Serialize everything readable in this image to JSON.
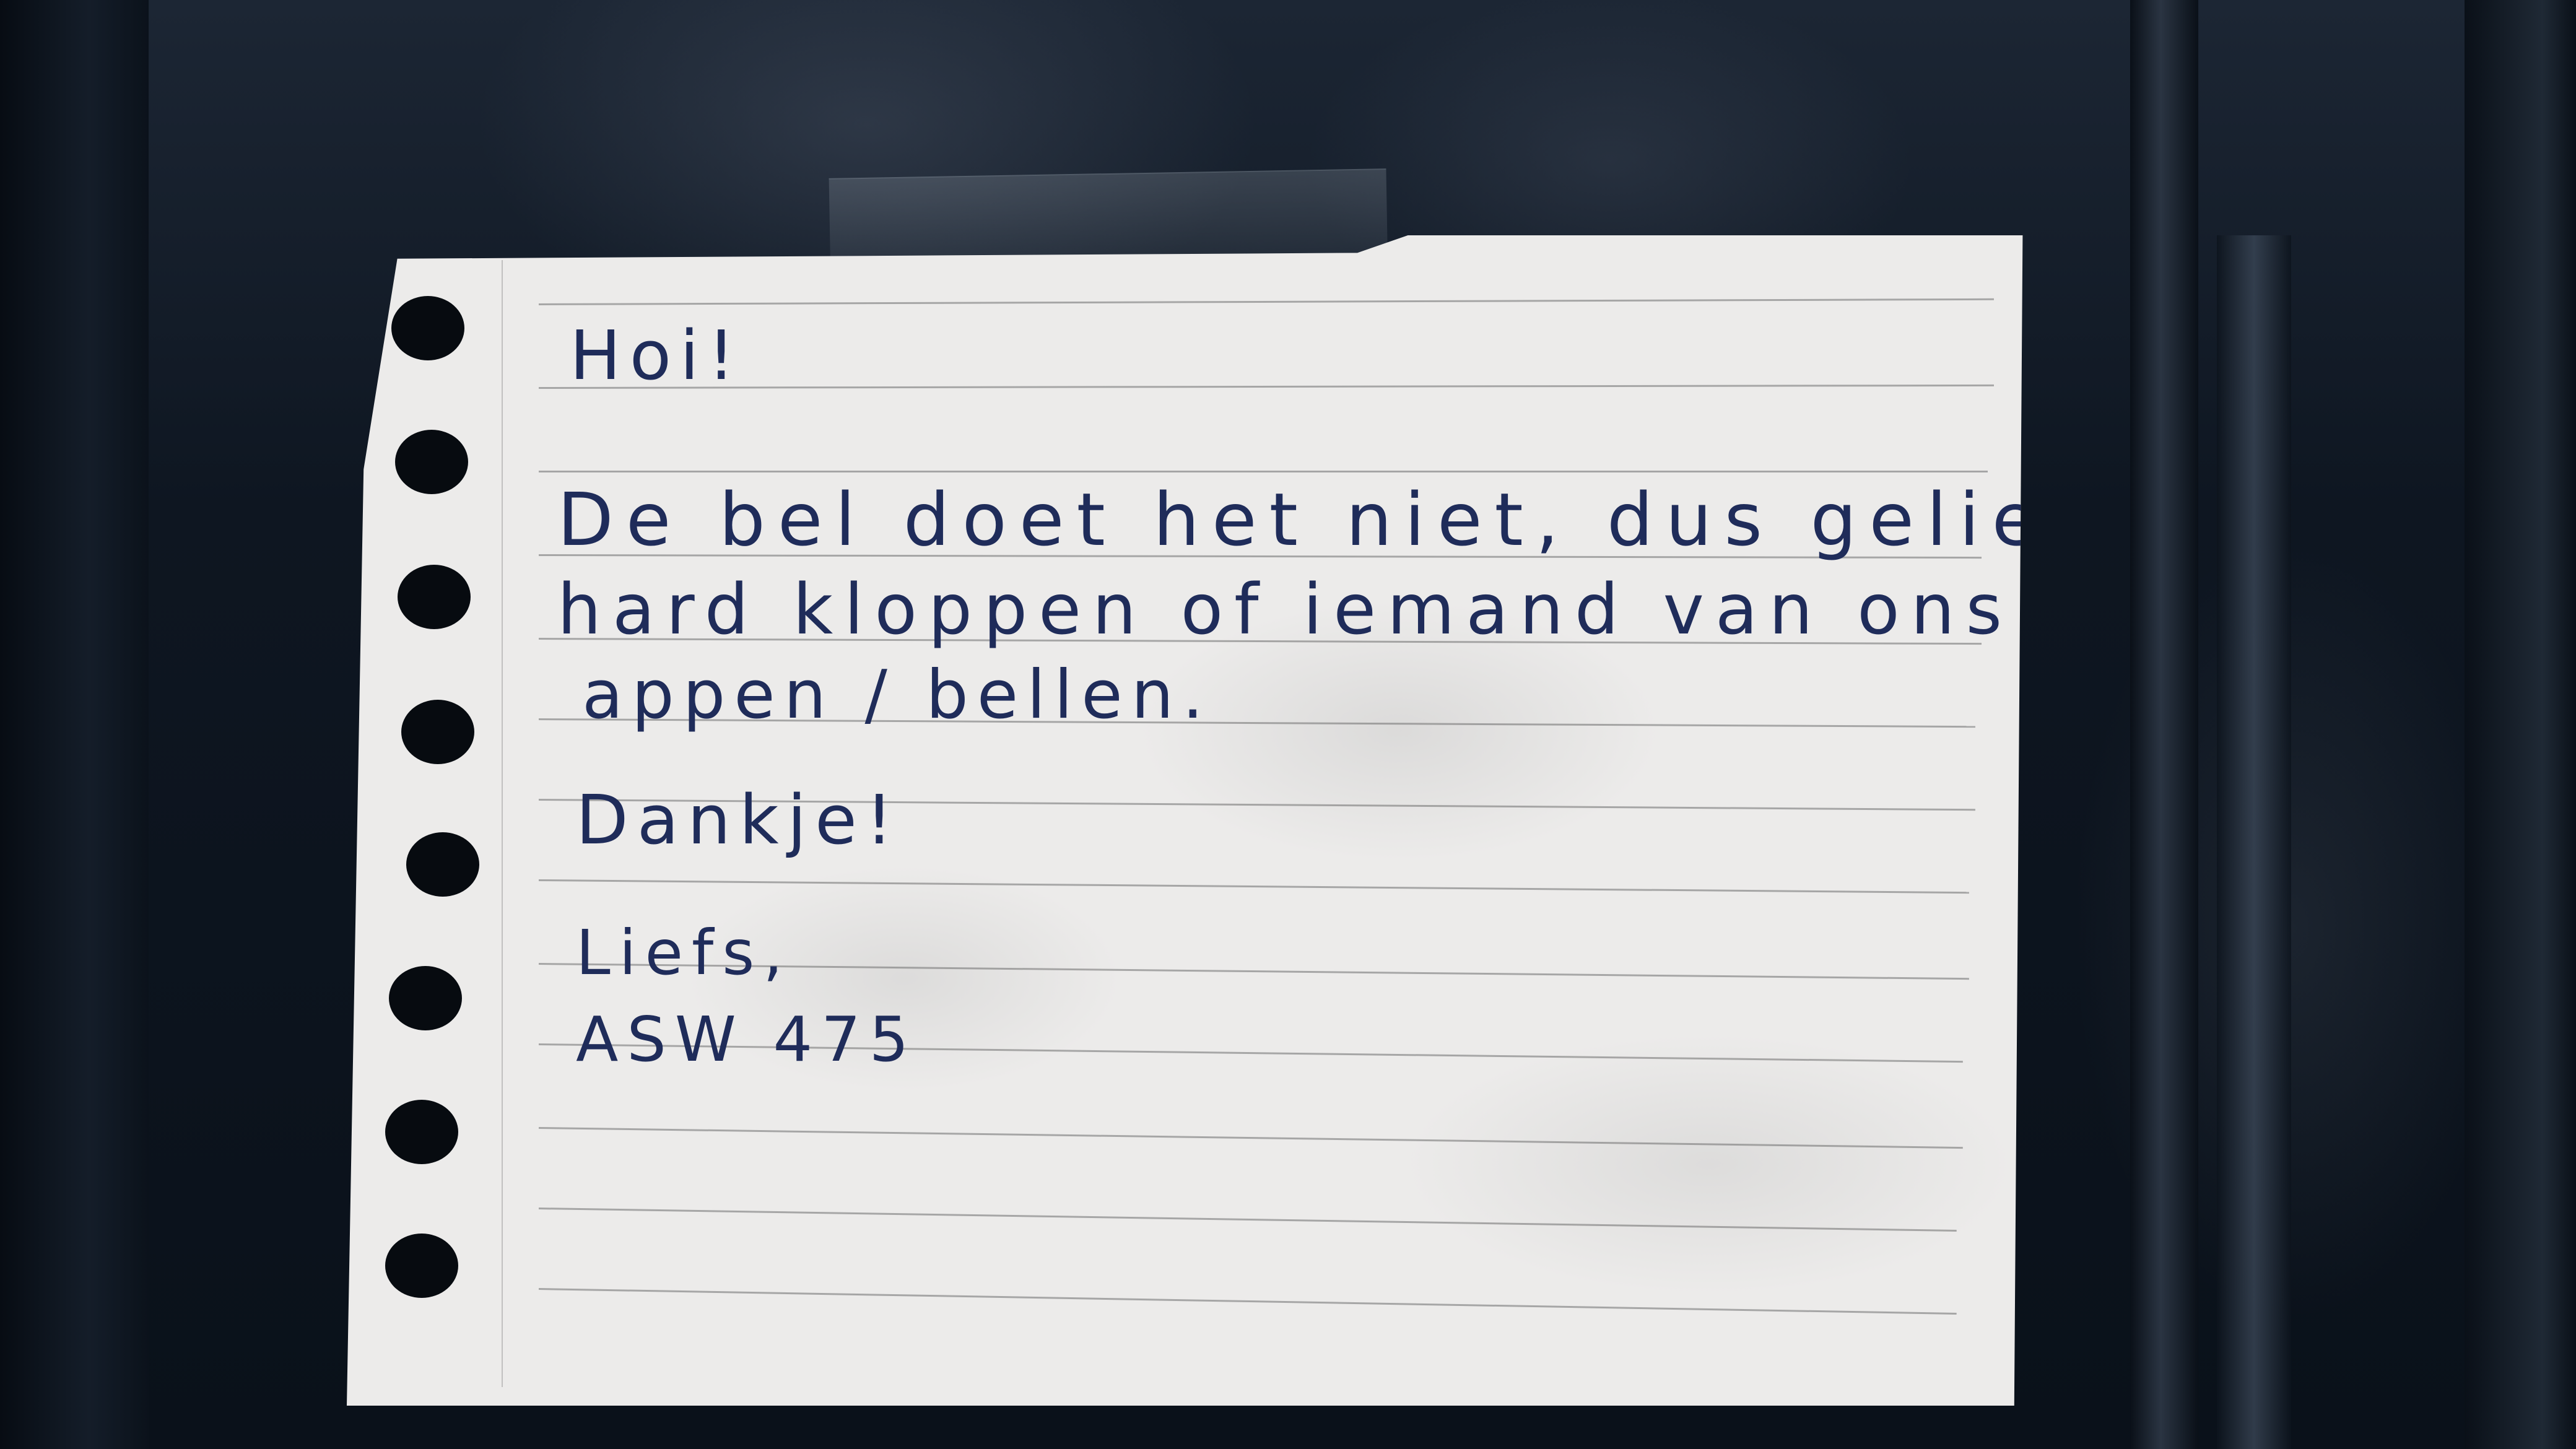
{
  "note": {
    "greeting": "Hoi!",
    "body_line_1": "De bel doet het niet, dus gelieve",
    "body_line_2": "hard kloppen of iemand van ons even",
    "body_line_3": "appen / bellen.",
    "thanks": "Dankje!",
    "closing": "Liefs,",
    "signature": "ASW 475"
  },
  "colors": {
    "door": "#0b121b",
    "paper": "#ecebea",
    "ink": "#1f2c5a"
  }
}
